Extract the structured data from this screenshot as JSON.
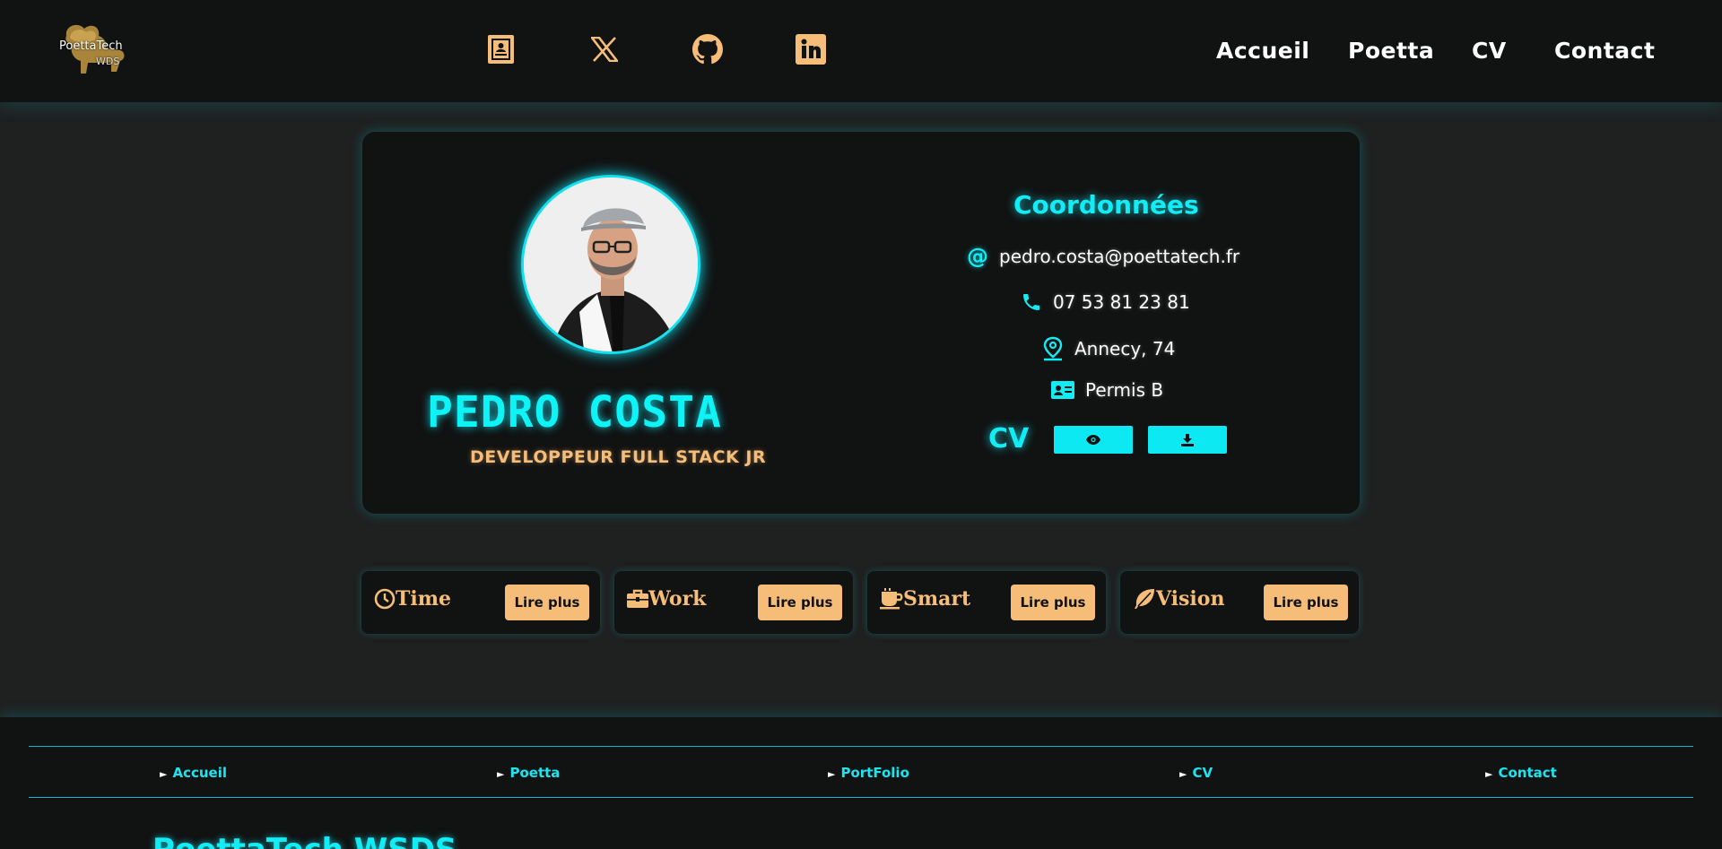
{
  "header": {
    "logo_text": "PoettaTech",
    "logo_sub": "WDS",
    "social": [
      {
        "icon": "contact-card-icon"
      },
      {
        "icon": "x-twitter-icon"
      },
      {
        "icon": "github-icon"
      },
      {
        "icon": "linkedin-icon"
      }
    ],
    "nav": [
      "Accueil",
      "Poetta",
      "CV",
      "Contact"
    ]
  },
  "profile": {
    "name": "PEDRO COSTA",
    "role": "DEVELOPPEUR FULL STACK JR"
  },
  "coordinates": {
    "title": "Coordonnées",
    "email": "pedro.costa@poettatech.fr",
    "phone": "07 53 81 23 81",
    "location": "Annecy, 74",
    "license": "Permis B",
    "cv_label": "CV"
  },
  "features": [
    {
      "title": "Time",
      "icon": "clock-icon",
      "button": "Lire plus"
    },
    {
      "title": "Work",
      "icon": "briefcase-icon",
      "button": "Lire plus"
    },
    {
      "title": "Smart",
      "icon": "coffee-cup-icon",
      "button": "Lire plus"
    },
    {
      "title": "Vision",
      "icon": "feather-icon",
      "button": "Lire plus"
    }
  ],
  "footer": {
    "links": [
      "Accueil",
      "Poetta",
      "PortFolio",
      "CV",
      "Contact"
    ],
    "brand": "PoettaTech WSDS"
  },
  "colors": {
    "accent_cyan": "#0ef4f6",
    "accent_orange": "#f6bd79",
    "background": "#1f2020",
    "panel": "#111212"
  }
}
